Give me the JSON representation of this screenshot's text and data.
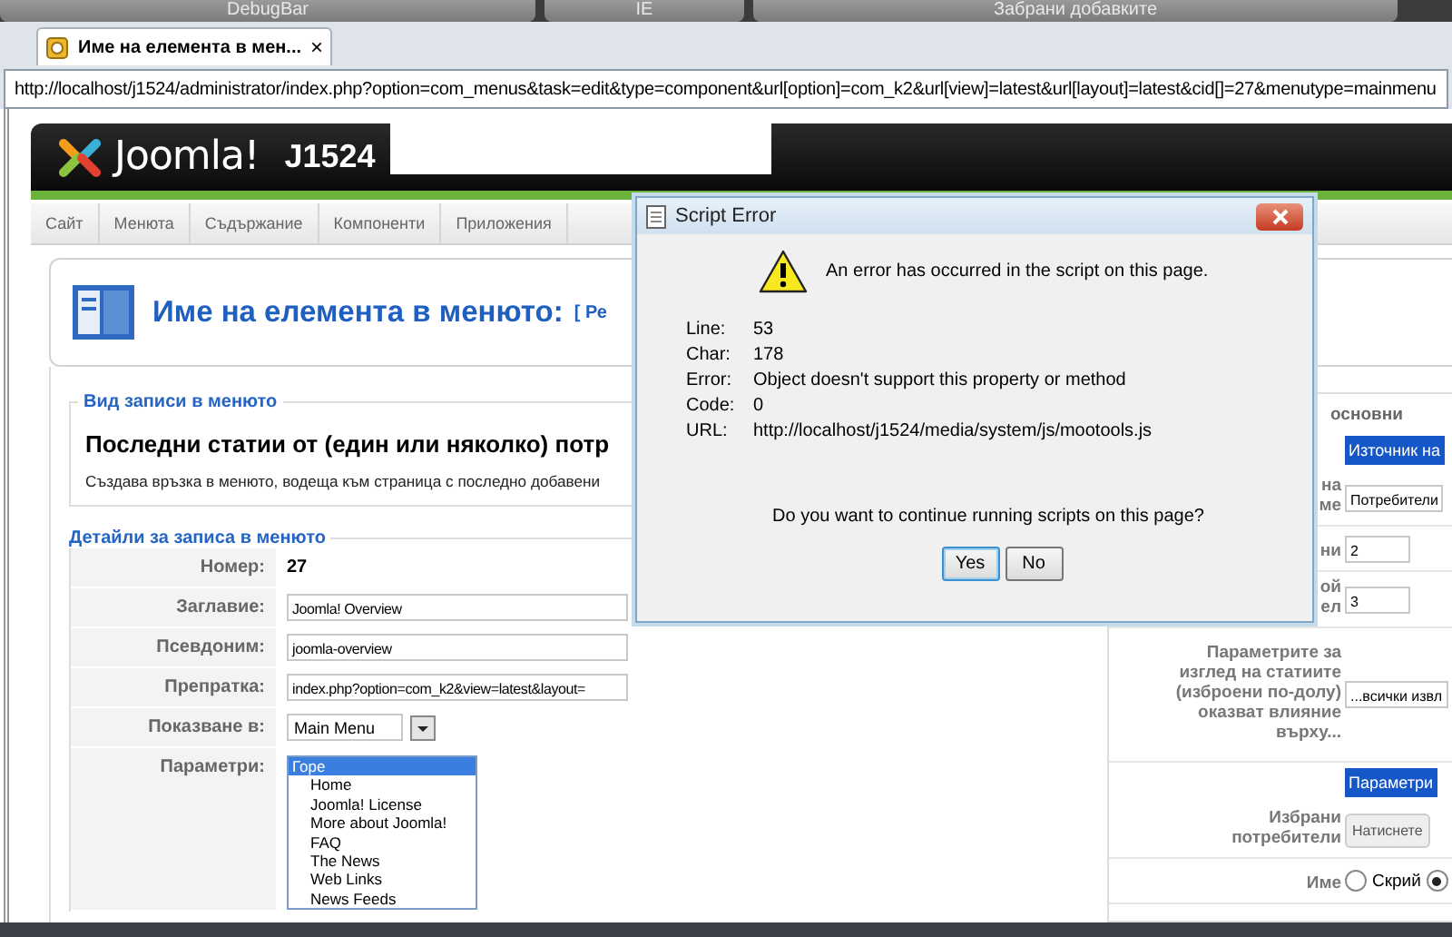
{
  "browser_toolbar": {
    "buttons": [
      "DebugBar",
      "IE",
      "Забрани добавките"
    ]
  },
  "tab": {
    "title": "Име на елемента в мен...",
    "close": "×"
  },
  "address_bar": {
    "url": "http://localhost/j1524/administrator/index.php?option=com_menus&task=edit&type=component&url[option]=com_k2&url[view]=latest&url[layout]=latest&cid[]=27&menutype=mainmenu"
  },
  "header": {
    "logo_text": "Joomla!",
    "site_name": "J1524"
  },
  "menu": [
    "Сайт",
    "Менюта",
    "Съдържание",
    "Компоненти",
    "Приложения"
  ],
  "page_title": {
    "text": "Име на елемента в менюто:",
    "suffix": "[ Ре"
  },
  "menu_type": {
    "legend": "Вид записи в менюто",
    "title": "Последни статии от (един или няколко) потр",
    "description": "Създава връзка в менюто, водеща към страница с последно добавени"
  },
  "details": {
    "legend": "Детайли за записа в менюто",
    "fields": [
      {
        "kind": "text",
        "label": "Номер:",
        "value": "27"
      },
      {
        "kind": "input",
        "label": "Заглавие:",
        "value": "Joomla! Overview"
      },
      {
        "kind": "input",
        "label": "Псевдоним:",
        "value": "joomla-overview"
      },
      {
        "kind": "input",
        "label": "Препратка:",
        "value": "index.php?option=com_k2&view=latest&layout="
      },
      {
        "kind": "select",
        "label": "Показване в:",
        "value": "Main Menu"
      },
      {
        "kind": "list",
        "label": "Параметри:",
        "options": [
          {
            "label": "Горе",
            "selected": true
          },
          {
            "label": "Home",
            "selected": false
          },
          {
            "label": "Joomla! License",
            "selected": false
          },
          {
            "label": "More about Joomla!",
            "selected": false
          },
          {
            "label": "FAQ",
            "selected": false
          },
          {
            "label": "The News",
            "selected": false
          },
          {
            "label": "Web Links",
            "selected": false
          },
          {
            "label": "News Feeds",
            "selected": false
          }
        ]
      }
    ]
  },
  "right_panel": {
    "heading": "основни",
    "rows": [
      {
        "kind": "bar",
        "text": "Източник на"
      },
      {
        "kind": "select",
        "label": "на\nме",
        "value": "Потребители"
      },
      {
        "kind": "input",
        "label": "ни",
        "value": "2"
      },
      {
        "kind": "input",
        "label": "ой\nел",
        "value": "3"
      },
      {
        "kind": "select",
        "label": "Параметрите за\nизглед на статиите\n(изброени по-долу)\nоказват влияние\nвърху...",
        "value": "...всички извл"
      },
      {
        "kind": "bar",
        "text": "Параметри"
      },
      {
        "kind": "button",
        "label": "Избрани\nпотребители",
        "value": "Натиснете"
      },
      {
        "kind": "radio",
        "label": "Име",
        "options": [
          {
            "label": "Скрий",
            "selected": false
          },
          {
            "selected": true
          }
        ]
      }
    ]
  },
  "dialog": {
    "title": "Script Error",
    "message": "An error has occurred in the script on this page.",
    "details": [
      {
        "label": "Line:",
        "value": "53"
      },
      {
        "label": "Char:",
        "value": "178"
      },
      {
        "label": "Error:",
        "value": "Object doesn't support this property or method"
      },
      {
        "label": "Code:",
        "value": "0"
      },
      {
        "label": "URL:",
        "value": "http://localhost/j1524/media/system/js/mootools.js"
      }
    ],
    "question": "Do you want to continue running scripts on this page?",
    "buttons": [
      "Yes",
      "No"
    ]
  }
}
